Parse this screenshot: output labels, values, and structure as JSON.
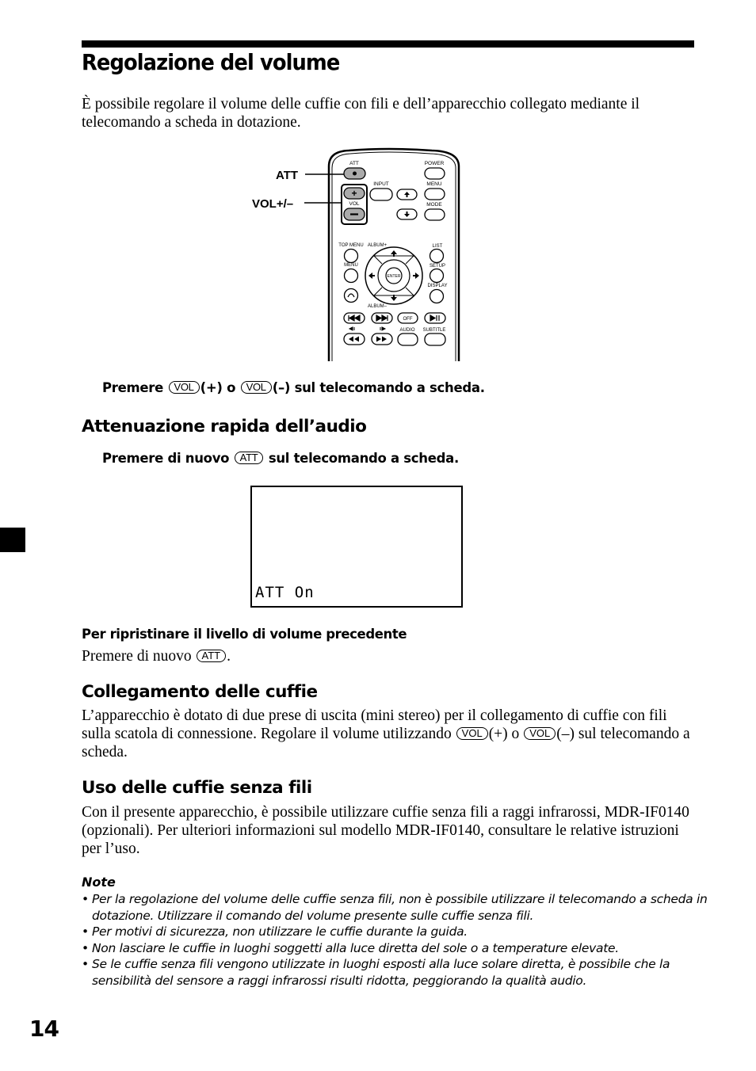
{
  "page": {
    "title": "Regolazione del volume",
    "intro": "È possibile regolare il volume delle cuffie con fili e dell’apparecchio collegato mediante il telecomando a scheda in dotazione.",
    "page_number": "14"
  },
  "remote_figure": {
    "callouts": {
      "att": "ATT",
      "vol": "VOL+/–"
    },
    "buttons": {
      "att": "ATT",
      "power": "POWER",
      "input": "INPUT",
      "menu_top": "MENU",
      "vol": "VOL",
      "plus": "+",
      "minus": "–",
      "mode": "MODE",
      "top_menu": "TOP MENU",
      "album_plus": "ALBUM+",
      "album_minus": "ALBUM–",
      "list": "LIST",
      "menu": "MENU",
      "setup": "SETUP",
      "display": "DISPLAY",
      "enter": "ENTER",
      "off": "OFF",
      "audio": "AUDIO",
      "subtitle": "SUBTITLE"
    }
  },
  "step_volume": {
    "prefix": "Premere",
    "key1": "VOL",
    "mid": "(+) o",
    "key2": "VOL",
    "suffix": "(–) sul telecomando a scheda."
  },
  "section_att": {
    "heading": "Attenuazione rapida dell’audio",
    "step_prefix": "Premere di nuovo",
    "step_key": "ATT",
    "step_suffix": "sul telecomando a scheda.",
    "display_text": "ATT On",
    "restore_heading": "Per ripristinare il livello di volume precedente",
    "restore_prefix": "Premere di nuovo",
    "restore_key": "ATT",
    "restore_suffix": "."
  },
  "section_wired": {
    "heading": "Collegamento delle cuffie",
    "text_part1": "L’apparecchio è dotato di due prese di uscita (mini stereo) per il collegamento di cuffie con fili sulla scatola di connessione. Regolare il volume utilizzando",
    "key1": "VOL",
    "text_part2": "(+) o",
    "key2": "VOL",
    "text_part3": "(–) sul telecomando a scheda."
  },
  "section_wireless": {
    "heading": "Uso delle cuffie senza fili",
    "text": "Con il presente apparecchio, è possibile utilizzare cuffie senza fili a raggi infrarossi, MDR-IF0140 (opzionali). Per ulteriori informazioni sul modello MDR-IF0140, consultare le relative istruzioni per l’uso."
  },
  "notes": {
    "title": "Note",
    "bullet": "•",
    "items": [
      "Per la regolazione del volume delle cuffie senza fili, non è possibile utilizzare il telecomando a scheda in dotazione. Utilizzare il comando del volume presente sulle cuffie senza fili.",
      "Per motivi di sicurezza, non utilizzare le cuffie durante la guida.",
      "Non lasciare le cuffie in luoghi soggetti alla luce diretta del sole o a temperature elevate.",
      "Se le cuffie senza fili vengono utilizzate in luoghi esposti alla luce solare diretta, è possibile che la sensibilità del sensore a raggi infrarossi risulti ridotta, peggiorando la qualità audio."
    ]
  }
}
